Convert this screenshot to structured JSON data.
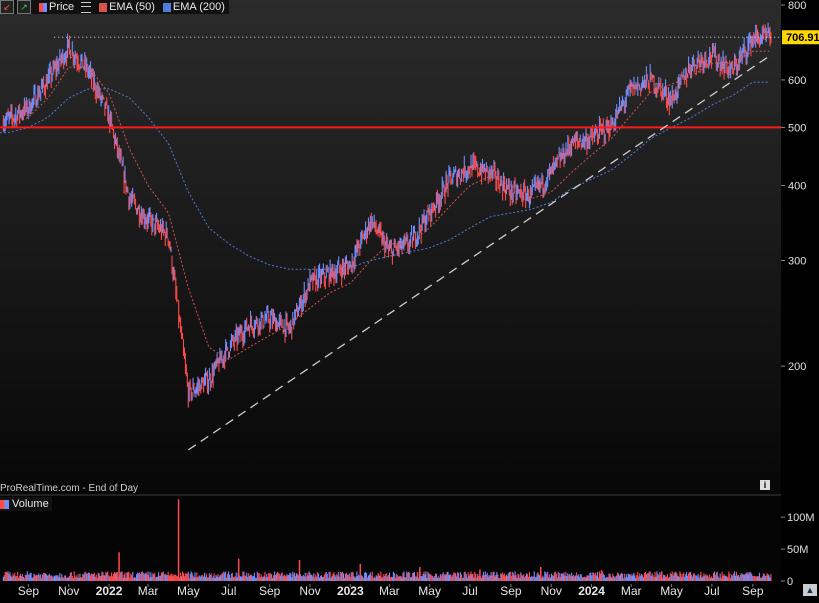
{
  "legend": {
    "price_label": "Price",
    "ema50_label": "EMA (50)",
    "ema200_label": "EMA (200)"
  },
  "volume_label": "Volume",
  "watermark": "ProRealTime.com - End of Day",
  "info_icon": "i",
  "colors": {
    "background": "#000000",
    "up": "#6f8fff",
    "down": "#ff4a4a",
    "ema50": "#d9534f",
    "ema200": "#4f7fd9",
    "support": "#ff1a1a",
    "trend": "#cfcfcf",
    "price_tag": "#ffd700"
  },
  "chart_data": [
    {
      "type": "line",
      "title": "",
      "scale": "log",
      "ylim": [
        140,
        800
      ],
      "yticks": [
        200,
        300,
        400,
        500,
        600,
        800
      ],
      "ytick_labels": [
        "200",
        "300",
        "400",
        "500",
        "600",
        "800"
      ],
      "x_tick_labels": [
        "Sep",
        "Nov",
        "2022",
        "Mar",
        "May",
        "Jul",
        "Sep",
        "Nov",
        "2023",
        "Mar",
        "May",
        "Jul",
        "Sep",
        "Nov",
        "2024",
        "Mar",
        "May",
        "Jul",
        "Sep"
      ],
      "x_dates": [
        "2021-08-01",
        "2021-09-01",
        "2021-10-01",
        "2021-11-01",
        "2021-12-01",
        "2022-01-01",
        "2022-02-01",
        "2022-03-01",
        "2022-04-01",
        "2022-05-01",
        "2022-06-01",
        "2022-07-01",
        "2022-08-01",
        "2022-09-01",
        "2022-10-01",
        "2022-11-01",
        "2022-12-01",
        "2023-01-01",
        "2023-02-01",
        "2023-03-01",
        "2023-04-01",
        "2023-05-01",
        "2023-06-01",
        "2023-07-01",
        "2023-08-01",
        "2023-09-01",
        "2023-10-01",
        "2023-11-01",
        "2023-12-01",
        "2024-01-01",
        "2024-02-01",
        "2024-03-01",
        "2024-04-01",
        "2024-05-01",
        "2024-06-01",
        "2024-07-01",
        "2024-08-01",
        "2024-09-01"
      ],
      "series": [
        {
          "name": "Price",
          "role": "price",
          "values": [
            515,
            540,
            600,
            680,
            620,
            520,
            380,
            350,
            330,
            180,
            190,
            215,
            235,
            240,
            230,
            275,
            285,
            295,
            350,
            310,
            320,
            360,
            410,
            430,
            420,
            390,
            385,
            420,
            470,
            480,
            505,
            580,
            600,
            555,
            640,
            660,
            620,
            705
          ]
        },
        {
          "name": "EMA (50)",
          "role": "ema50",
          "values": [
            500,
            520,
            560,
            630,
            630,
            570,
            460,
            400,
            360,
            270,
            215,
            205,
            215,
            225,
            235,
            250,
            265,
            275,
            300,
            320,
            320,
            340,
            370,
            400,
            415,
            400,
            380,
            390,
            420,
            450,
            480,
            525,
            575,
            590,
            610,
            640,
            640,
            670
          ]
        },
        {
          "name": "EMA (200)",
          "role": "ema200",
          "values": [
            490,
            500,
            520,
            560,
            580,
            580,
            560,
            520,
            470,
            390,
            340,
            320,
            305,
            295,
            290,
            290,
            290,
            292,
            300,
            305,
            310,
            315,
            325,
            340,
            355,
            360,
            365,
            375,
            395,
            410,
            425,
            450,
            480,
            500,
            520,
            545,
            565,
            595
          ]
        }
      ],
      "last_price": 706.91,
      "last_price_label": "706.91",
      "previous_high": 706.91,
      "support_level": 500,
      "trendline": {
        "from": {
          "date": "2022-05-01",
          "value": 145
        },
        "to": {
          "date": "2024-09-01",
          "value": 655
        }
      },
      "grid": false
    },
    {
      "type": "bar",
      "title": "",
      "series_name": "Volume",
      "ylim": [
        0,
        130000000
      ],
      "yticks": [
        0,
        50000000,
        100000000
      ],
      "ytick_labels": [
        "0",
        "50M",
        "100M"
      ],
      "typical_volume": 9000000,
      "spikes": [
        {
          "date": "2022-01-01",
          "value": 45000000
        },
        {
          "date": "2022-04-01",
          "value": 128000000
        },
        {
          "date": "2022-07-01",
          "value": 35000000
        },
        {
          "date": "2022-10-01",
          "value": 33000000
        },
        {
          "date": "2023-01-01",
          "value": 27000000
        },
        {
          "date": "2023-04-01",
          "value": 22000000
        },
        {
          "date": "2023-07-01",
          "value": 18000000
        },
        {
          "date": "2023-10-01",
          "value": 22000000
        },
        {
          "date": "2024-01-01",
          "value": 17000000
        },
        {
          "date": "2024-04-01",
          "value": 15000000
        }
      ]
    }
  ]
}
